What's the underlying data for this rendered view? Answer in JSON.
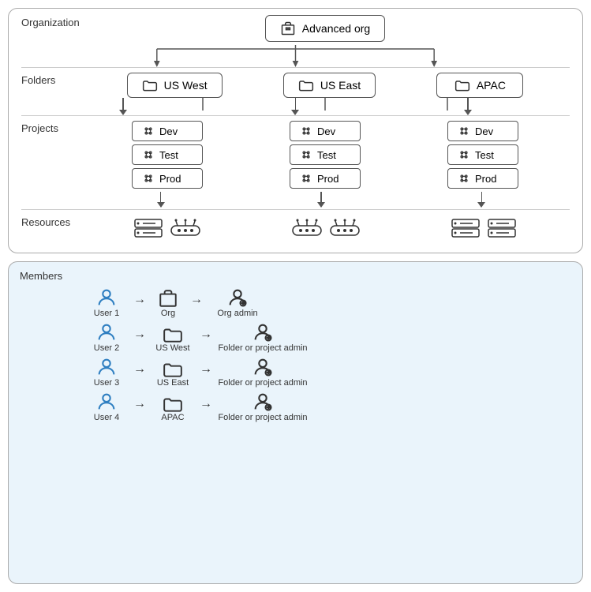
{
  "org": {
    "label": "Organization",
    "name": "Advanced org"
  },
  "folders": {
    "label": "Folders",
    "items": [
      "US West",
      "US East",
      "APAC"
    ]
  },
  "projects": {
    "label": "Projects",
    "groups": [
      [
        "Dev",
        "Test",
        "Prod"
      ],
      [
        "Dev",
        "Test",
        "Prod"
      ],
      [
        "Dev",
        "Test",
        "Prod"
      ]
    ]
  },
  "resources": {
    "label": "Resources"
  },
  "members": {
    "label": "Members",
    "rows": [
      {
        "user": "User 1",
        "target": "Org",
        "role": "Org admin"
      },
      {
        "user": "User 2",
        "target": "US West",
        "role": "Folder or project admin"
      },
      {
        "user": "User 3",
        "target": "US East",
        "role": "Folder or project admin"
      },
      {
        "user": "User 4",
        "target": "APAC",
        "role": "Folder or project admin"
      }
    ]
  }
}
